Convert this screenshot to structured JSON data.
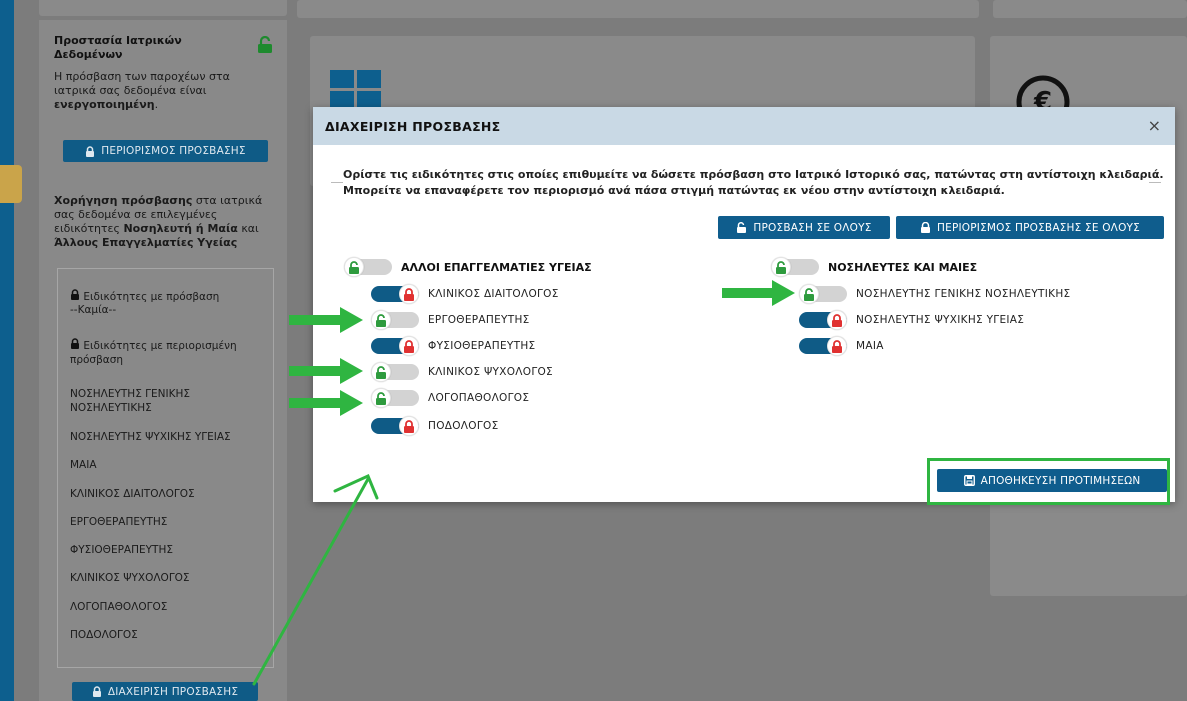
{
  "sidebar": {
    "title": "Προστασία Ιατρικών Δεδομένων",
    "desc_prefix": "Η πρόσβαση των παροχέων στα ιατρικά σας δεδομένα είναι",
    "desc_bold": "ενεργοποιημένη",
    "desc_suffix": ".",
    "restrict_button": "ΠΕΡΙΟΡΙΣΜΟΣ ΠΡΟΣΒΑΣΗΣ",
    "grant_bold": "Χορήγηση πρόσβασης",
    "grant_text1": " στα ιατρικά σας δεδομένα σε επιλεγμένες ειδικότητες ",
    "grant_bold2": "Νοσηλευτή ή Μαία",
    "grant_text2": " και ",
    "grant_bold3": "Άλλους Επαγγελματίες Υγείας",
    "with_access_label": "Ειδικότητες με πρόσβαση",
    "with_access_none": "--Καμία--",
    "restricted_label": "Ειδικότητες με περιορισμένη πρόσβαση",
    "restricted_items": [
      "ΝΟΣΗΛΕΥΤΗΣ ΓΕΝΙΚΗΣ ΝΟΣΗΛΕΥΤΙΚΗΣ",
      "ΝΟΣΗΛΕΥΤΗΣ ΨΥΧΙΚΗΣ ΥΓΕΙΑΣ",
      "ΜΑΙΑ",
      "ΚΛΙΝΙΚΟΣ ΔΙΑΙΤΟΛΟΓΟΣ",
      "ΕΡΓΟΘΕΡΑΠΕΥΤΗΣ",
      "ΦΥΣΙΟΘΕΡΑΠΕΥΤΗΣ",
      "ΚΛΙΝΙΚΟΣ ΨΥΧΟΛΟΓΟΣ",
      "ΛΟΓΟΠΑΘΟΛΟΓΟΣ",
      "ΠΟΔΟΛΟΓΟΣ"
    ],
    "manage_button": "ΔΙΑΧΕΙΡΙΣΗ ΠΡΟΣΒΑΣΗΣ"
  },
  "modal": {
    "title": "ΔΙΑΧΕΙΡΙΣΗ ΠΡΟΣΒΑΣΗΣ",
    "close_glyph": "×",
    "instruction_line1": "Ορίστε τις ειδικότητες στις οποίες επιθυμείτε να δώσετε πρόσβαση στο Ιατρικό Ιστορικό σας, πατώντας στη αντίστοιχη κλειδαριά.",
    "instruction_line2": "Μπορείτε να επαναφέρετε τον περιορισμό ανά πάσα στιγμή πατώντας εκ νέου στην αντίστοιχη κλειδαριά.",
    "access_all_button": "ΠΡΟΣΒΑΣΗ ΣΕ ΟΛΟΥΣ",
    "restrict_all_button": "ΠΕΡΙΟΡΙΣΜΟΣ ΠΡΟΣΒΑΣΗΣ ΣΕ ΟΛΟΥΣ",
    "save_button": "ΑΠΟΘΗΚΕΥΣΗ ΠΡΟΤΙΜΗΣΕΩΝ",
    "groups": [
      {
        "title": "ΑΛΛΟΙ ΕΠΑΓΓΕΛΜΑΤΙΕΣ ΥΓΕΙΑΣ",
        "master_state": "unlocked",
        "items": [
          {
            "label": "ΚΛΙΝΙΚΟΣ ΔΙΑΙΤΟΛΟΓΟΣ",
            "state": "locked"
          },
          {
            "label": "ΕΡΓΟΘΕΡΑΠΕΥΤΗΣ",
            "state": "unlocked"
          },
          {
            "label": "ΦΥΣΙΟΘΕΡΑΠΕΥΤΗΣ",
            "state": "locked"
          },
          {
            "label": "ΚΛΙΝΙΚΟΣ ΨΥΧΟΛΟΓΟΣ",
            "state": "unlocked"
          },
          {
            "label": "ΛΟΓΟΠΑΘΟΛΟΓΟΣ",
            "state": "unlocked"
          },
          {
            "label": "ΠΟΔΟΛΟΓΟΣ",
            "state": "locked"
          }
        ]
      },
      {
        "title": "ΝΟΣΗΛΕΥΤΕΣ ΚΑΙ ΜΑΙΕΣ",
        "master_state": "unlocked",
        "items": [
          {
            "label": "ΝΟΣΗΛΕΥΤΗΣ ΓΕΝΙΚΗΣ ΝΟΣΗΛΕΥΤΙΚΗΣ",
            "state": "unlocked"
          },
          {
            "label": "ΝΟΣΗΛΕΥΤΗΣ ΨΥΧΙΚΗΣ ΥΓΕΙΑΣ",
            "state": "locked"
          },
          {
            "label": "ΜΑΙΑ",
            "state": "locked"
          }
        ]
      }
    ]
  },
  "colors": {
    "primary": "#0f5b86",
    "unlock_green": "#2e9b3e",
    "lock_red": "#e03131",
    "annotation_green": "#2fb541",
    "header_bg": "#c9d9e5"
  },
  "icons": {
    "lock_closed": "lock-icon",
    "lock_open": "unlock-icon",
    "save": "save-icon",
    "close": "close-icon"
  }
}
